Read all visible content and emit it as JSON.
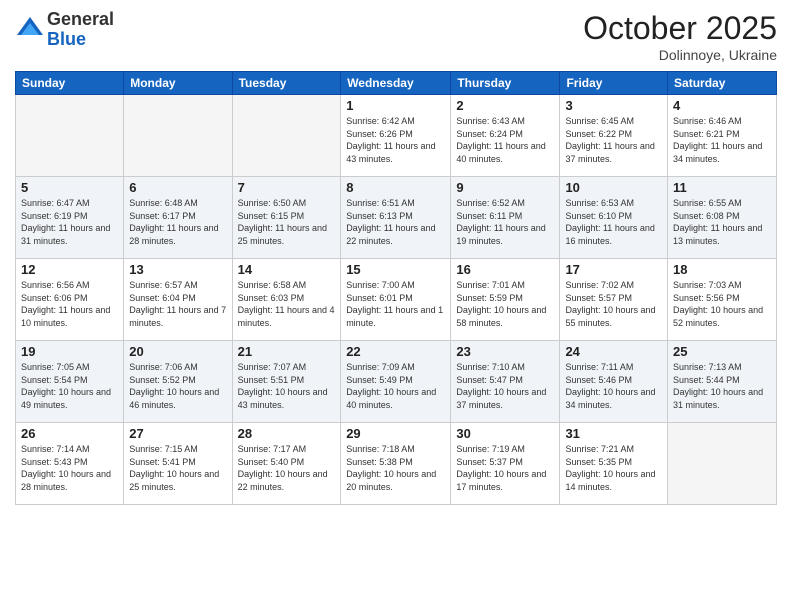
{
  "header": {
    "logo_general": "General",
    "logo_blue": "Blue",
    "month": "October 2025",
    "location": "Dolinnoye, Ukraine"
  },
  "days_of_week": [
    "Sunday",
    "Monday",
    "Tuesday",
    "Wednesday",
    "Thursday",
    "Friday",
    "Saturday"
  ],
  "weeks": [
    [
      {
        "day": "",
        "empty": true
      },
      {
        "day": "",
        "empty": true
      },
      {
        "day": "",
        "empty": true
      },
      {
        "day": "1",
        "sunrise": "6:42 AM",
        "sunset": "6:26 PM",
        "daylight": "11 hours and 43 minutes."
      },
      {
        "day": "2",
        "sunrise": "6:43 AM",
        "sunset": "6:24 PM",
        "daylight": "11 hours and 40 minutes."
      },
      {
        "day": "3",
        "sunrise": "6:45 AM",
        "sunset": "6:22 PM",
        "daylight": "11 hours and 37 minutes."
      },
      {
        "day": "4",
        "sunrise": "6:46 AM",
        "sunset": "6:21 PM",
        "daylight": "11 hours and 34 minutes."
      }
    ],
    [
      {
        "day": "5",
        "sunrise": "6:47 AM",
        "sunset": "6:19 PM",
        "daylight": "11 hours and 31 minutes."
      },
      {
        "day": "6",
        "sunrise": "6:48 AM",
        "sunset": "6:17 PM",
        "daylight": "11 hours and 28 minutes."
      },
      {
        "day": "7",
        "sunrise": "6:50 AM",
        "sunset": "6:15 PM",
        "daylight": "11 hours and 25 minutes."
      },
      {
        "day": "8",
        "sunrise": "6:51 AM",
        "sunset": "6:13 PM",
        "daylight": "11 hours and 22 minutes."
      },
      {
        "day": "9",
        "sunrise": "6:52 AM",
        "sunset": "6:11 PM",
        "daylight": "11 hours and 19 minutes."
      },
      {
        "day": "10",
        "sunrise": "6:53 AM",
        "sunset": "6:10 PM",
        "daylight": "11 hours and 16 minutes."
      },
      {
        "day": "11",
        "sunrise": "6:55 AM",
        "sunset": "6:08 PM",
        "daylight": "11 hours and 13 minutes."
      }
    ],
    [
      {
        "day": "12",
        "sunrise": "6:56 AM",
        "sunset": "6:06 PM",
        "daylight": "11 hours and 10 minutes."
      },
      {
        "day": "13",
        "sunrise": "6:57 AM",
        "sunset": "6:04 PM",
        "daylight": "11 hours and 7 minutes."
      },
      {
        "day": "14",
        "sunrise": "6:58 AM",
        "sunset": "6:03 PM",
        "daylight": "11 hours and 4 minutes."
      },
      {
        "day": "15",
        "sunrise": "7:00 AM",
        "sunset": "6:01 PM",
        "daylight": "11 hours and 1 minute."
      },
      {
        "day": "16",
        "sunrise": "7:01 AM",
        "sunset": "5:59 PM",
        "daylight": "10 hours and 58 minutes."
      },
      {
        "day": "17",
        "sunrise": "7:02 AM",
        "sunset": "5:57 PM",
        "daylight": "10 hours and 55 minutes."
      },
      {
        "day": "18",
        "sunrise": "7:03 AM",
        "sunset": "5:56 PM",
        "daylight": "10 hours and 52 minutes."
      }
    ],
    [
      {
        "day": "19",
        "sunrise": "7:05 AM",
        "sunset": "5:54 PM",
        "daylight": "10 hours and 49 minutes."
      },
      {
        "day": "20",
        "sunrise": "7:06 AM",
        "sunset": "5:52 PM",
        "daylight": "10 hours and 46 minutes."
      },
      {
        "day": "21",
        "sunrise": "7:07 AM",
        "sunset": "5:51 PM",
        "daylight": "10 hours and 43 minutes."
      },
      {
        "day": "22",
        "sunrise": "7:09 AM",
        "sunset": "5:49 PM",
        "daylight": "10 hours and 40 minutes."
      },
      {
        "day": "23",
        "sunrise": "7:10 AM",
        "sunset": "5:47 PM",
        "daylight": "10 hours and 37 minutes."
      },
      {
        "day": "24",
        "sunrise": "7:11 AM",
        "sunset": "5:46 PM",
        "daylight": "10 hours and 34 minutes."
      },
      {
        "day": "25",
        "sunrise": "7:13 AM",
        "sunset": "5:44 PM",
        "daylight": "10 hours and 31 minutes."
      }
    ],
    [
      {
        "day": "26",
        "sunrise": "7:14 AM",
        "sunset": "5:43 PM",
        "daylight": "10 hours and 28 minutes."
      },
      {
        "day": "27",
        "sunrise": "7:15 AM",
        "sunset": "5:41 PM",
        "daylight": "10 hours and 25 minutes."
      },
      {
        "day": "28",
        "sunrise": "7:17 AM",
        "sunset": "5:40 PM",
        "daylight": "10 hours and 22 minutes."
      },
      {
        "day": "29",
        "sunrise": "7:18 AM",
        "sunset": "5:38 PM",
        "daylight": "10 hours and 20 minutes."
      },
      {
        "day": "30",
        "sunrise": "7:19 AM",
        "sunset": "5:37 PM",
        "daylight": "10 hours and 17 minutes."
      },
      {
        "day": "31",
        "sunrise": "7:21 AM",
        "sunset": "5:35 PM",
        "daylight": "10 hours and 14 minutes."
      },
      {
        "day": "",
        "empty": true
      }
    ]
  ]
}
